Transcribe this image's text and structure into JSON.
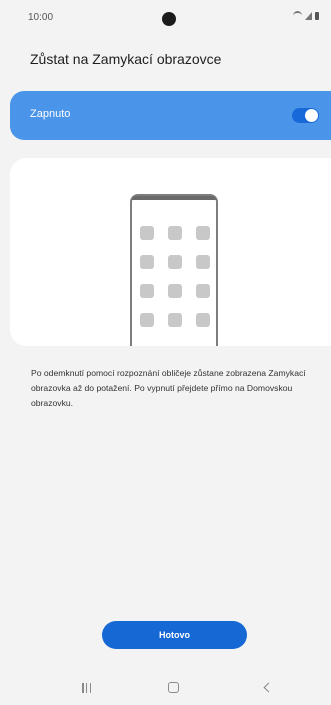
{
  "status_bar": {
    "time": "10:00",
    "icons": [
      "wifi-icon",
      "signal-icon",
      "battery-icon"
    ]
  },
  "page": {
    "title": "Zůstat na Zamykací obrazovce"
  },
  "toggle": {
    "label": "Zapnuto",
    "state": "on",
    "accent_color": "#4a95e9"
  },
  "illustration": {
    "icon": "phone-app-grid-icon"
  },
  "description": "Po odemknutí pomocí rozpoznání obličeje zůstane zobrazena Zamykací obrazovka až do potažení. Po vypnutí přejdete přímo na Domovskou obrazovku.",
  "actions": {
    "done_label": "Hotovo",
    "done_color": "#1669d4"
  },
  "navigation": {
    "buttons": [
      "recent-apps-icon",
      "home-icon",
      "back-icon"
    ]
  }
}
